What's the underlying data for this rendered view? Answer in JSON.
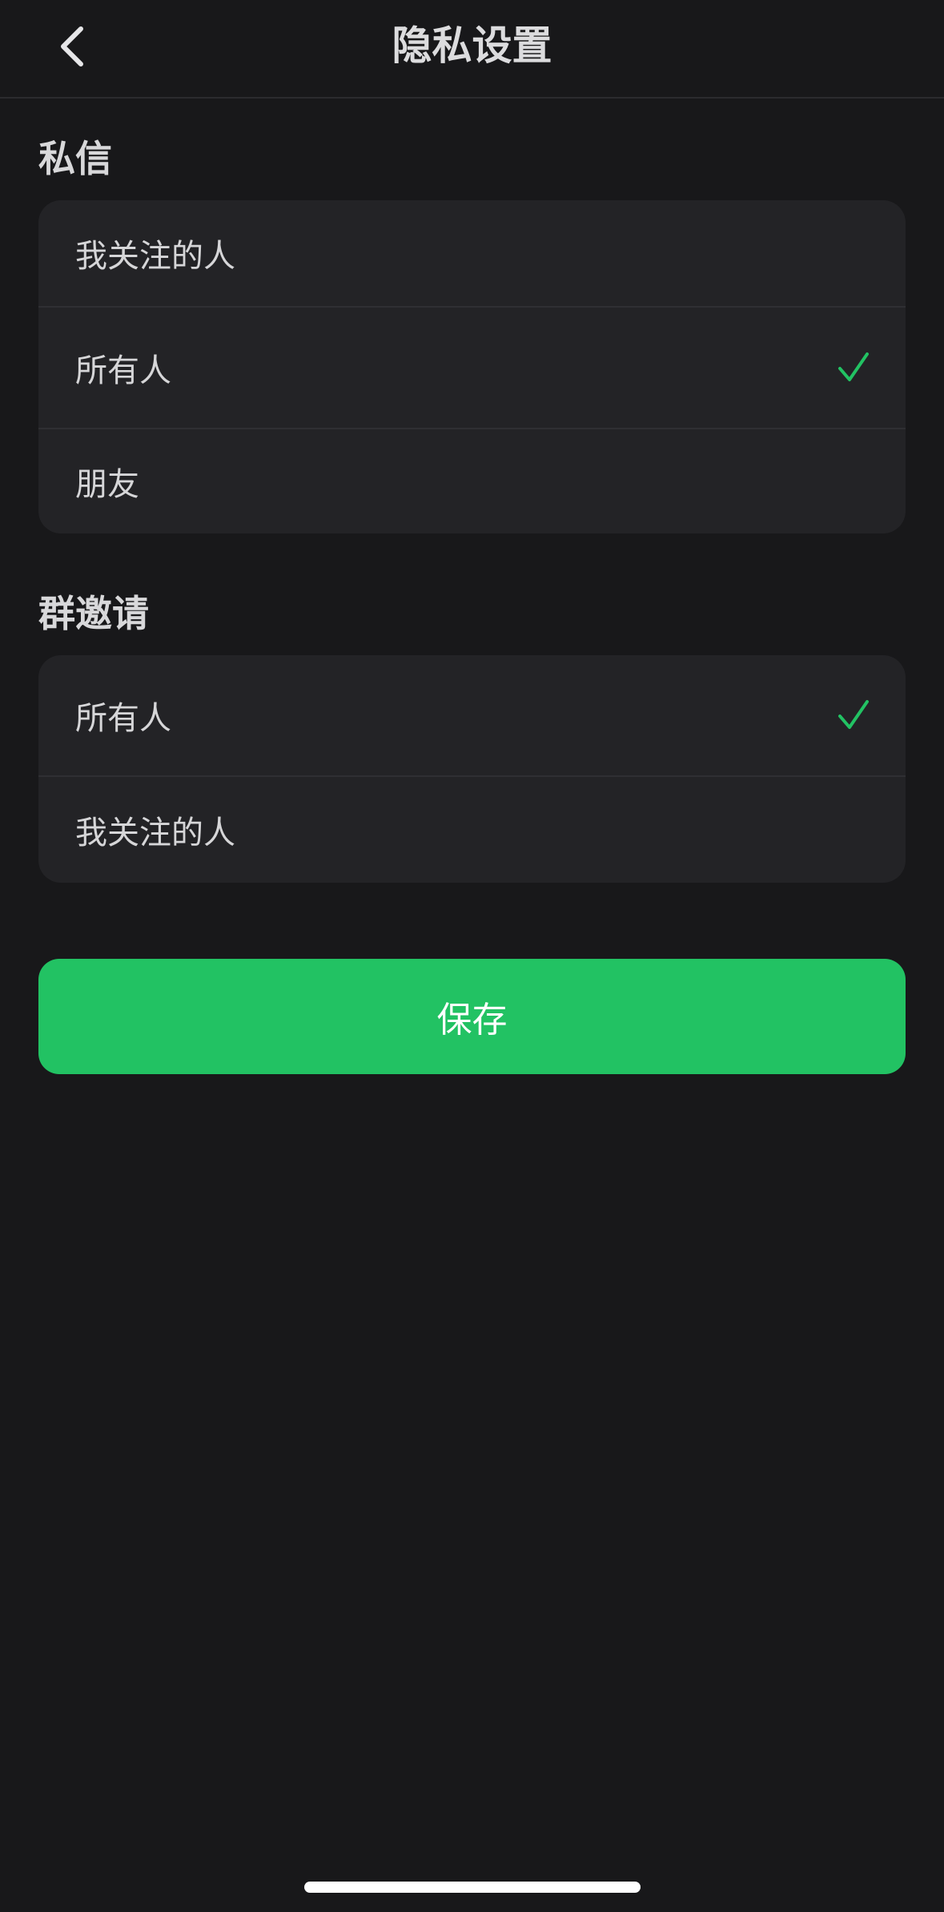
{
  "header": {
    "title": "隐私设置",
    "back_icon": "chevron-left-icon"
  },
  "sections": [
    {
      "label": "私信",
      "options": [
        {
          "label": "我关注的人",
          "selected": false
        },
        {
          "label": "所有人",
          "selected": true
        },
        {
          "label": "朋友",
          "selected": false
        }
      ]
    },
    {
      "label": "群邀请",
      "options": [
        {
          "label": "所有人",
          "selected": true
        },
        {
          "label": "我关注的人",
          "selected": false
        }
      ]
    }
  ],
  "save_button": {
    "label": "保存"
  },
  "colors": {
    "background": "#18181a",
    "card": "#232326",
    "accent": "#22c263",
    "check": "#22c263"
  }
}
